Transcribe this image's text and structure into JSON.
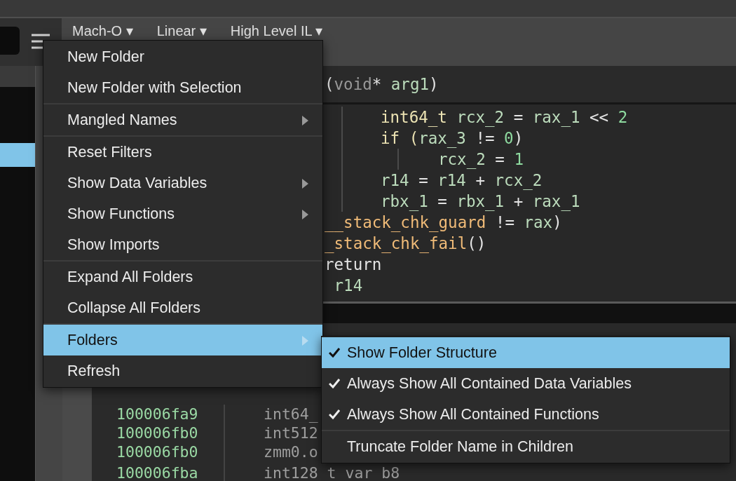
{
  "toolbar": {
    "view_selectors": [
      "Mach-O ▾",
      "Linear ▾",
      "High Level IL ▾"
    ]
  },
  "sidebar": {
    "rows": [
      {
        "selected": true
      }
    ]
  },
  "code": {
    "signature": [
      {
        "text": "(",
        "kind": "op"
      },
      {
        "text": "void",
        "kind": "dim"
      },
      {
        "text": "* ",
        "kind": "op"
      },
      {
        "text": "arg1",
        "kind": "var"
      },
      {
        "text": ")",
        "kind": "op"
      }
    ],
    "lines": [
      {
        "kind": "inner",
        "tokens": [
          {
            "text": "int64_t ",
            "kind": "type"
          },
          {
            "text": "rcx_2",
            "kind": "var"
          },
          {
            "text": " = ",
            "kind": "op"
          },
          {
            "text": "rax_1",
            "kind": "var"
          },
          {
            "text": " << ",
            "kind": "op"
          },
          {
            "text": "2",
            "kind": "num"
          }
        ]
      },
      {
        "kind": "inner",
        "tokens": [
          {
            "text": "if (",
            "kind": "type"
          },
          {
            "text": "rax_3",
            "kind": "var"
          },
          {
            "text": " != ",
            "kind": "op"
          },
          {
            "text": "0",
            "kind": "num"
          },
          {
            "text": ")",
            "kind": "op"
          }
        ]
      },
      {
        "kind": "deepest",
        "tokens": [
          {
            "text": "rcx_2",
            "kind": "var"
          },
          {
            "text": " = ",
            "kind": "op"
          },
          {
            "text": "1",
            "kind": "num"
          }
        ]
      },
      {
        "kind": "inner",
        "tokens": [
          {
            "text": "r14",
            "kind": "var"
          },
          {
            "text": " = ",
            "kind": "op"
          },
          {
            "text": "r14",
            "kind": "var"
          },
          {
            "text": " + ",
            "kind": "op"
          },
          {
            "text": "rcx_2",
            "kind": "var"
          }
        ]
      },
      {
        "kind": "inner",
        "tokens": [
          {
            "text": "rbx_1",
            "kind": "var"
          },
          {
            "text": " = ",
            "kind": "op"
          },
          {
            "text": "rbx_1",
            "kind": "var"
          },
          {
            "text": " + ",
            "kind": "op"
          },
          {
            "text": "rax_1",
            "kind": "var"
          }
        ]
      },
      {
        "kind": "outer",
        "tokens": [
          {
            "text": "__stack_chk_guard",
            "kind": "func"
          },
          {
            "text": " != ",
            "kind": "op"
          },
          {
            "text": "rax",
            "kind": "var"
          },
          {
            "text": ")",
            "kind": "op"
          }
        ]
      },
      {
        "kind": "outer",
        "tokens": [
          {
            "text": "_stack_chk_fail",
            "kind": "func"
          },
          {
            "text": "()",
            "kind": "op"
          }
        ]
      },
      {
        "kind": "outer",
        "tokens": [
          {
            "text": "return",
            "kind": "op"
          }
        ]
      },
      {
        "kind": "outer",
        "tokens": [
          {
            "text": " r14",
            "kind": "var"
          }
        ]
      }
    ]
  },
  "variables": {
    "rows": [
      {
        "address": "100006fa9",
        "type": "int64_"
      },
      {
        "address": "100006fb0",
        "type": "int512"
      },
      {
        "address": "100006fb0",
        "type": "zmm0.o"
      },
      {
        "address": "100006fba",
        "type": "int128_t var_b8"
      }
    ]
  },
  "context_menu": {
    "groups": [
      [
        {
          "label": "New Folder",
          "submenu": false,
          "selected": false
        },
        {
          "label": "New Folder with Selection",
          "submenu": false,
          "selected": false
        }
      ],
      [
        {
          "label": "Mangled Names",
          "submenu": true,
          "selected": false
        }
      ],
      [
        {
          "label": "Reset Filters",
          "submenu": false,
          "selected": false
        },
        {
          "label": "Show Data Variables",
          "submenu": true,
          "selected": false
        },
        {
          "label": "Show Functions",
          "submenu": true,
          "selected": false
        },
        {
          "label": "Show Imports",
          "submenu": false,
          "selected": false
        }
      ],
      [
        {
          "label": "Expand All Folders",
          "submenu": false,
          "selected": false
        },
        {
          "label": "Collapse All Folders",
          "submenu": false,
          "selected": false
        }
      ],
      [
        {
          "label": "Folders",
          "submenu": true,
          "selected": true
        },
        {
          "label": "Refresh",
          "submenu": false,
          "selected": false
        }
      ]
    ]
  },
  "submenu": {
    "groups": [
      [
        {
          "label": "Show Folder Structure",
          "checked": true,
          "selected": true
        },
        {
          "label": "Always Show All Contained Data Variables",
          "checked": true,
          "selected": false
        },
        {
          "label": "Always Show All Contained Functions",
          "checked": true,
          "selected": false
        }
      ],
      [
        {
          "label": "Truncate Folder Name in Children",
          "checked": false,
          "selected": false
        }
      ]
    ]
  }
}
